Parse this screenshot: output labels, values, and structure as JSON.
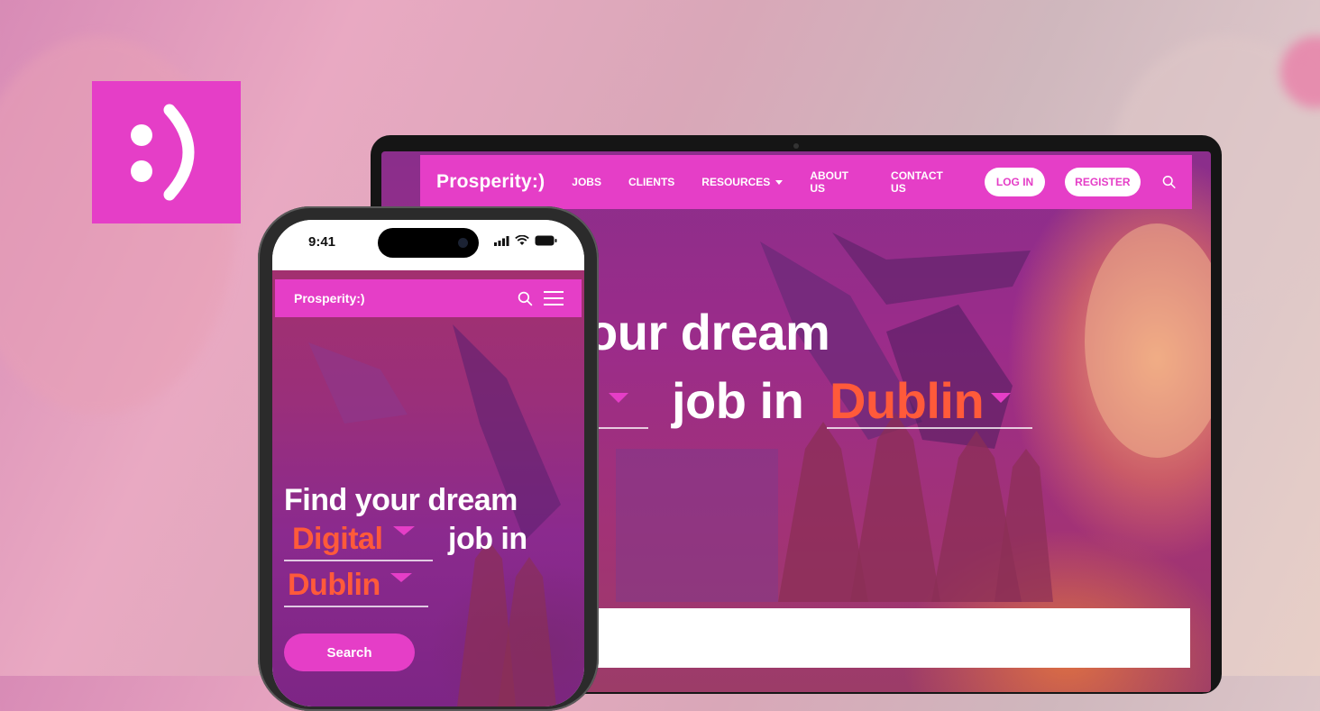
{
  "brand": {
    "color_primary": "#e53ec7",
    "color_accent": "#ff5a3a",
    "logo_icon": "smiley-icon"
  },
  "laptop": {
    "nav": {
      "logo": "Prosperity:)",
      "links": [
        "JOBS",
        "CLIENTS",
        "RESOURCES",
        "ABOUT US",
        "CONTACT US"
      ],
      "login": "LOG IN",
      "register": "REGISTER",
      "search_icon": "search-icon"
    },
    "hero": {
      "line1": "our dream",
      "line2": "job in",
      "city": "Dublin"
    }
  },
  "phone": {
    "status": {
      "time": "9:41"
    },
    "nav": {
      "logo": "Prosperity:)",
      "search_icon": "search-icon",
      "menu_icon": "menu-icon"
    },
    "hero": {
      "line1": "Find your dream",
      "category": "Digital",
      "line2": "job in",
      "city": "Dublin"
    },
    "search_label": "Search"
  }
}
